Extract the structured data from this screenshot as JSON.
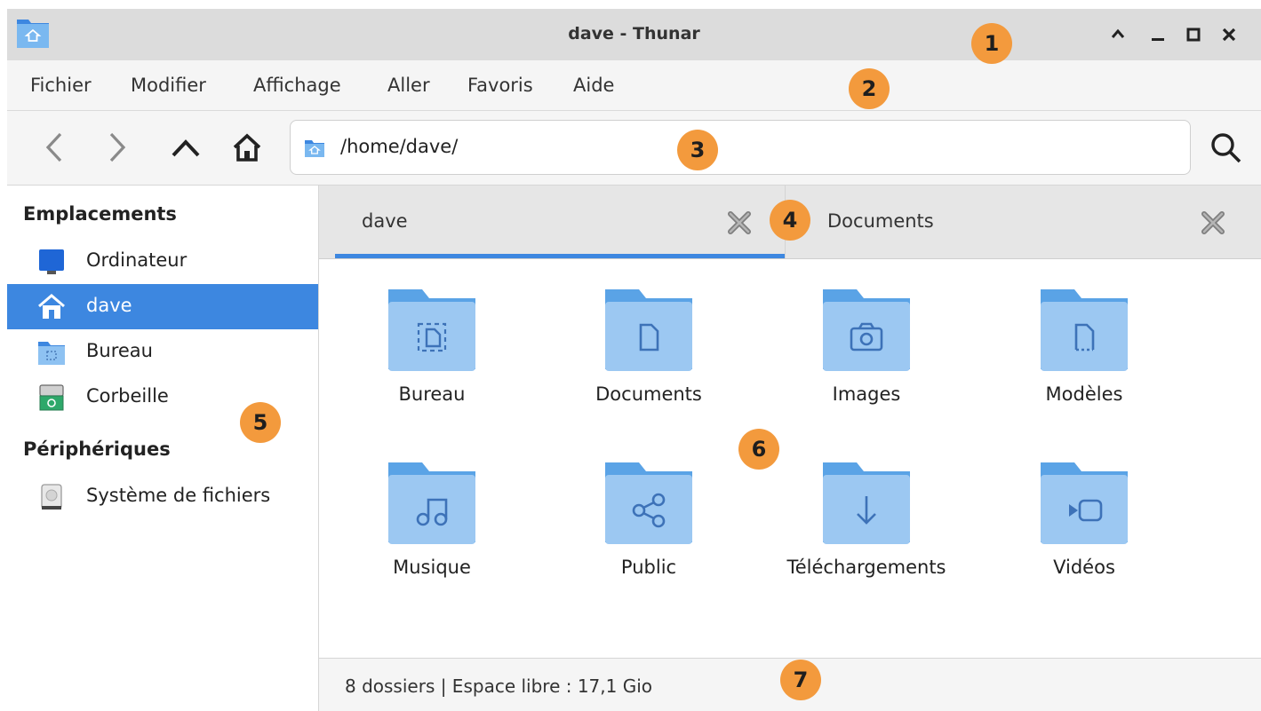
{
  "window": {
    "title": "dave - Thunar"
  },
  "colors": {
    "accent": "#3d87e0",
    "callout": "#f39a3d",
    "folder": "#9cc8f2",
    "folder_tab": "#5aa3e6"
  },
  "titlebar": {
    "buttons": [
      "shade-icon",
      "minimize-icon",
      "maximize-icon",
      "close-icon"
    ]
  },
  "menubar": {
    "items": [
      "Fichier",
      "Modifier",
      "Affichage",
      "Aller",
      "Favoris",
      "Aide"
    ]
  },
  "toolbar": {
    "path": "/home/dave/",
    "buttons": [
      "back-icon",
      "forward-icon",
      "up-icon",
      "home-icon"
    ],
    "search_icon": "search-icon"
  },
  "sidebar": {
    "headings": [
      "Emplacements",
      "Périphériques"
    ],
    "places": [
      {
        "label": "Ordinateur",
        "icon": "computer-icon"
      },
      {
        "label": "dave",
        "icon": "home-icon",
        "selected": true
      },
      {
        "label": "Bureau",
        "icon": "desktop-folder-icon"
      },
      {
        "label": "Corbeille",
        "icon": "trash-icon"
      }
    ],
    "devices": [
      {
        "label": "Système de fichiers",
        "icon": "drive-icon"
      }
    ]
  },
  "tabs": [
    {
      "label": "dave",
      "active": true
    },
    {
      "label": "Documents",
      "active": false
    }
  ],
  "folders": [
    {
      "label": "Bureau",
      "glyph": "desktop-glyph"
    },
    {
      "label": "Documents",
      "glyph": "document-glyph"
    },
    {
      "label": "Images",
      "glyph": "camera-glyph"
    },
    {
      "label": "Modèles",
      "glyph": "template-glyph"
    },
    {
      "label": "Musique",
      "glyph": "music-glyph"
    },
    {
      "label": "Public",
      "glyph": "share-glyph"
    },
    {
      "label": "Téléchargements",
      "glyph": "download-glyph"
    },
    {
      "label": "Vidéos",
      "glyph": "video-glyph"
    }
  ],
  "statusbar": {
    "text": "8 dossiers  |  Espace libre : 17,1 Gio"
  },
  "callouts": [
    "1",
    "2",
    "3",
    "4",
    "5",
    "6",
    "7"
  ]
}
